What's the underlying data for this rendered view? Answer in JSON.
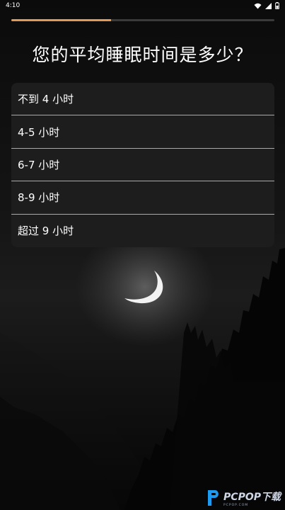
{
  "status_bar": {
    "time": "4:10"
  },
  "progress": {
    "value": 0.38
  },
  "question": "您的平均睡眠时间是多少？",
  "options": [
    {
      "label": "不到 4 小时"
    },
    {
      "label": "4-5 小时"
    },
    {
      "label": "6-7 小时"
    },
    {
      "label": "8-9 小时"
    },
    {
      "label": "超过 9 小时"
    }
  ],
  "watermark": {
    "brand": "PCPOP下载",
    "sub": "PCPOP.COM"
  },
  "colors": {
    "accent": "#e39a57",
    "panel": "#1d1d1d",
    "divider": "#a9a9a9"
  }
}
